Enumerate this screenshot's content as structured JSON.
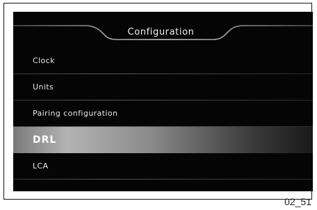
{
  "screen": {
    "title": "Configuration",
    "menu": [
      {
        "label": "Clock",
        "selected": false
      },
      {
        "label": "Units",
        "selected": false
      },
      {
        "label": "Pairing configuration",
        "selected": false
      },
      {
        "label": "DRL",
        "selected": true
      },
      {
        "label": "LCA",
        "selected": false
      }
    ]
  },
  "caption": "02_51",
  "colors": {
    "screen_background": "#050505",
    "text": "#e8e8e8",
    "selected_highlight": "#b3b3b3"
  }
}
